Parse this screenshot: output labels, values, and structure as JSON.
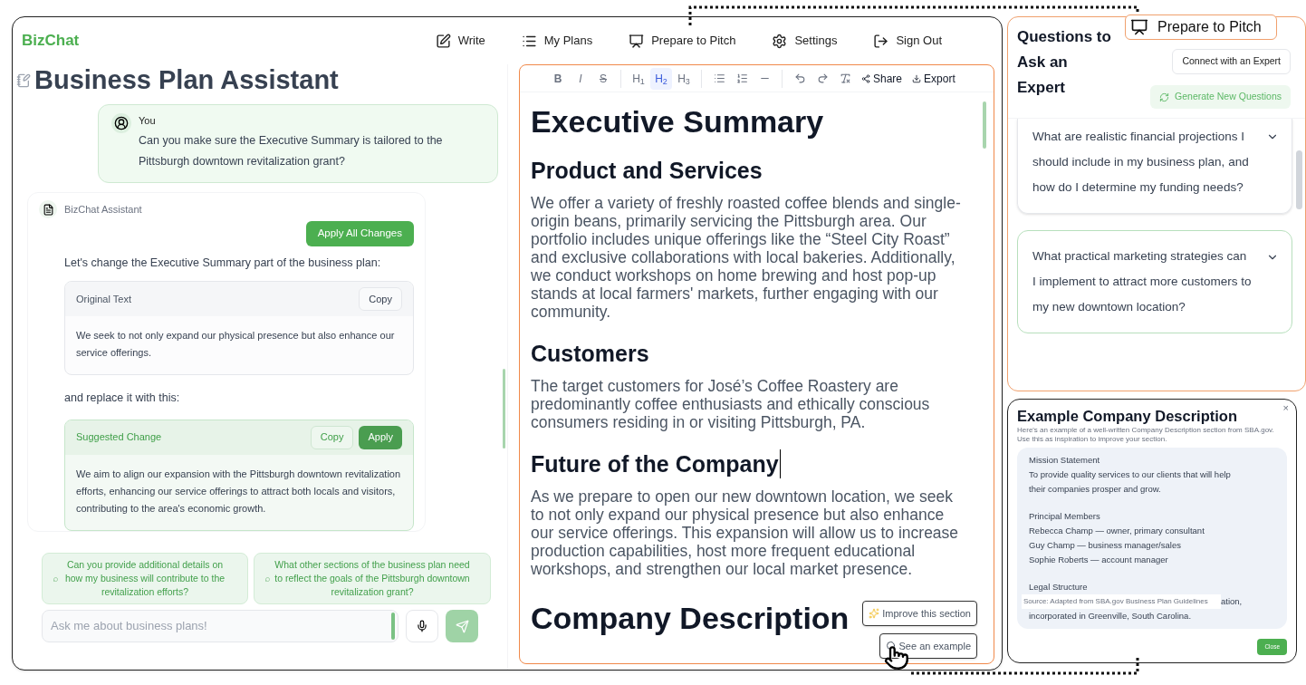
{
  "app": {
    "brand": "BizChat",
    "nav": [
      {
        "label": "Write"
      },
      {
        "label": "My Plans"
      },
      {
        "label": "Prepare to Pitch"
      },
      {
        "label": "Settings"
      },
      {
        "label": "Sign Out"
      }
    ]
  },
  "chat": {
    "title": "Business Plan Assistant",
    "user_message": {
      "author": "You",
      "text": "Can you make sure the Executive Summary is tailored to the Pittsburgh downtown revitalization grant?"
    },
    "assistant_message": {
      "author": "BizChat Assistant",
      "apply_all": "Apply All Changes",
      "intro": "Let's change the Executive Summary part of the business plan:",
      "original": {
        "label": "Original Text",
        "copy": "Copy",
        "text": "We seek to not only expand our physical presence but also enhance our service offerings."
      },
      "between": "and replace it with this:",
      "suggested": {
        "label": "Suggested Change",
        "copy": "Copy",
        "apply": "Apply",
        "text": "We aim to align our expansion with the Pittsburgh downtown revitalization efforts, enhancing our service offerings to attract both locals and visitors, contributing to the area's economic growth."
      }
    },
    "suggestions": [
      "Can you provide additional details on how my business will contribute to the revitalization efforts?",
      "What other sections of the business plan need to reflect the goals of the Pittsburgh downtown revitalization grant?"
    ],
    "input": {
      "placeholder": "Ask me about business plans!"
    }
  },
  "editor": {
    "toolbar": [
      {
        "kind": "bold",
        "label": "B",
        "selected": false
      },
      {
        "kind": "italic",
        "label": "I",
        "selected": false
      },
      {
        "kind": "strike",
        "label": "S",
        "selected": false
      },
      {
        "kind": "divider"
      },
      {
        "kind": "heading",
        "label": "H$_{1}$",
        "selected": false
      },
      {
        "kind": "heading",
        "label": "H$_{2}$",
        "selected": true
      },
      {
        "kind": "heading",
        "label": "H$_{3}$",
        "selected": false
      },
      {
        "kind": "divider"
      },
      {
        "kind": "bullet-list",
        "selected": false
      },
      {
        "kind": "numbered-list",
        "selected": false
      },
      {
        "kind": "rule",
        "selected": false
      },
      {
        "kind": "divider"
      },
      {
        "kind": "undo",
        "selected": false
      },
      {
        "kind": "redo",
        "selected": false
      },
      {
        "kind": "clear-format",
        "selected": false
      },
      {
        "kind": "share",
        "label": "Share",
        "selected": false
      },
      {
        "kind": "export",
        "label": "Export",
        "selected": false
      }
    ],
    "content": [
      {
        "kind": "h1",
        "text": "Executive Summary"
      },
      {
        "kind": "h2",
        "text": "Product and Services"
      },
      {
        "kind": "p",
        "text": "We offer a variety of freshly roasted coffee blends and single-origin beans, primarily servicing the Pittsburgh area. Our portfolio includes unique offerings like the “Steel City Roast” and exclusive collaborations with local bakeries. Additionally, we conduct workshops on home brewing and host pop-up stands at local farmers' markets, further engaging with our community."
      },
      {
        "kind": "h2",
        "text": "Customers"
      },
      {
        "kind": "p",
        "text": "The target customers for José’s Coffee Roastery are predominantly coffee enthusiasts and ethically conscious consumers residing in or visiting Pittsburgh, PA."
      },
      {
        "kind": "h2",
        "text": "Future of the Company",
        "caret": true
      },
      {
        "kind": "p",
        "text": "As we prepare to open our new downtown location, we seek to not only expand our physical presence but also enhance our service offerings. This expansion will allow us to increase production capabilities, host more frequent educational workshops, and strengthen our local market presence."
      },
      {
        "kind": "h1",
        "text": "Company Description"
      }
    ],
    "actions": [
      {
        "kind": "improve",
        "label": "Improve this section"
      },
      {
        "kind": "example",
        "label": "See an example"
      }
    ]
  },
  "questions": {
    "badge": "Prepare to Pitch",
    "title": "Questions to Ask an Expert",
    "connect": "Connect with an Expert",
    "generate": "Generate New Questions",
    "items": [
      {
        "text": "What are realistic financial projections I should include in my business plan, and how do I determine my funding needs?",
        "selected": false
      },
      {
        "text": "What practical marketing strategies can I implement to attract more customers to my new downtown location?",
        "selected": true
      }
    ]
  },
  "example": {
    "title": "Example Company Description",
    "close_icon": "×",
    "subtitle": "Here's an example of a well-written Company Description section from SBA.gov. Use this as inspiration to improve your section.",
    "sections": [
      {
        "heading": "Mission Statement",
        "lines": [
          "To provide quality services to our clients that will help",
          "their companies prosper and grow."
        ]
      },
      {
        "heading": "Principal Members",
        "lines": [
          "Rebecca Champ — owner, primary consultant",
          "Guy Champ — business manager/sales",
          "Sophie Roberts — account manager"
        ]
      },
      {
        "heading": "Legal Structure",
        "source": "Source: Adapted from SBA.gov Business Plan Guidelines",
        "lines": [
          "ation,",
          "incorporated in Greenville, South Carolina."
        ]
      }
    ],
    "close": "Close"
  }
}
